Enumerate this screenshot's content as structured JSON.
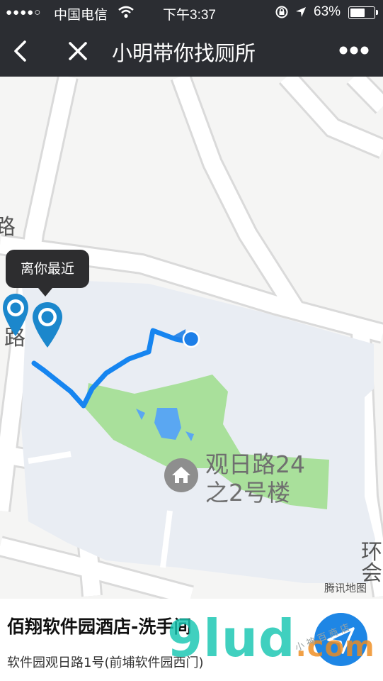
{
  "status_bar": {
    "signal": "●●●●○",
    "carrier": "中国电信",
    "time": "下午3:37",
    "battery_percent": "63%",
    "battery_level": 0.63
  },
  "nav": {
    "title": "小明带你找厕所"
  },
  "map": {
    "tooltip": "离你最近",
    "poi_line1": "观日路24",
    "poi_line2": "之2号楼",
    "road_fragment_1": "环",
    "road_fragment_2": "会",
    "road_fragment_3": "路",
    "credit": "腾讯地图",
    "colors": {
      "route": "#1685f0",
      "park": "#a9e09b",
      "water": "#5aa7f2",
      "building": "#e9edf3",
      "pin": "#1b87cc"
    }
  },
  "location": {
    "name": "佰翔软件园酒店-洗手间",
    "address": "软件园观日路1号(前埔软件园西门)"
  },
  "watermark": {
    "main": "9lud",
    "suffix": ".com",
    "script": "小 神 百 商 店"
  }
}
